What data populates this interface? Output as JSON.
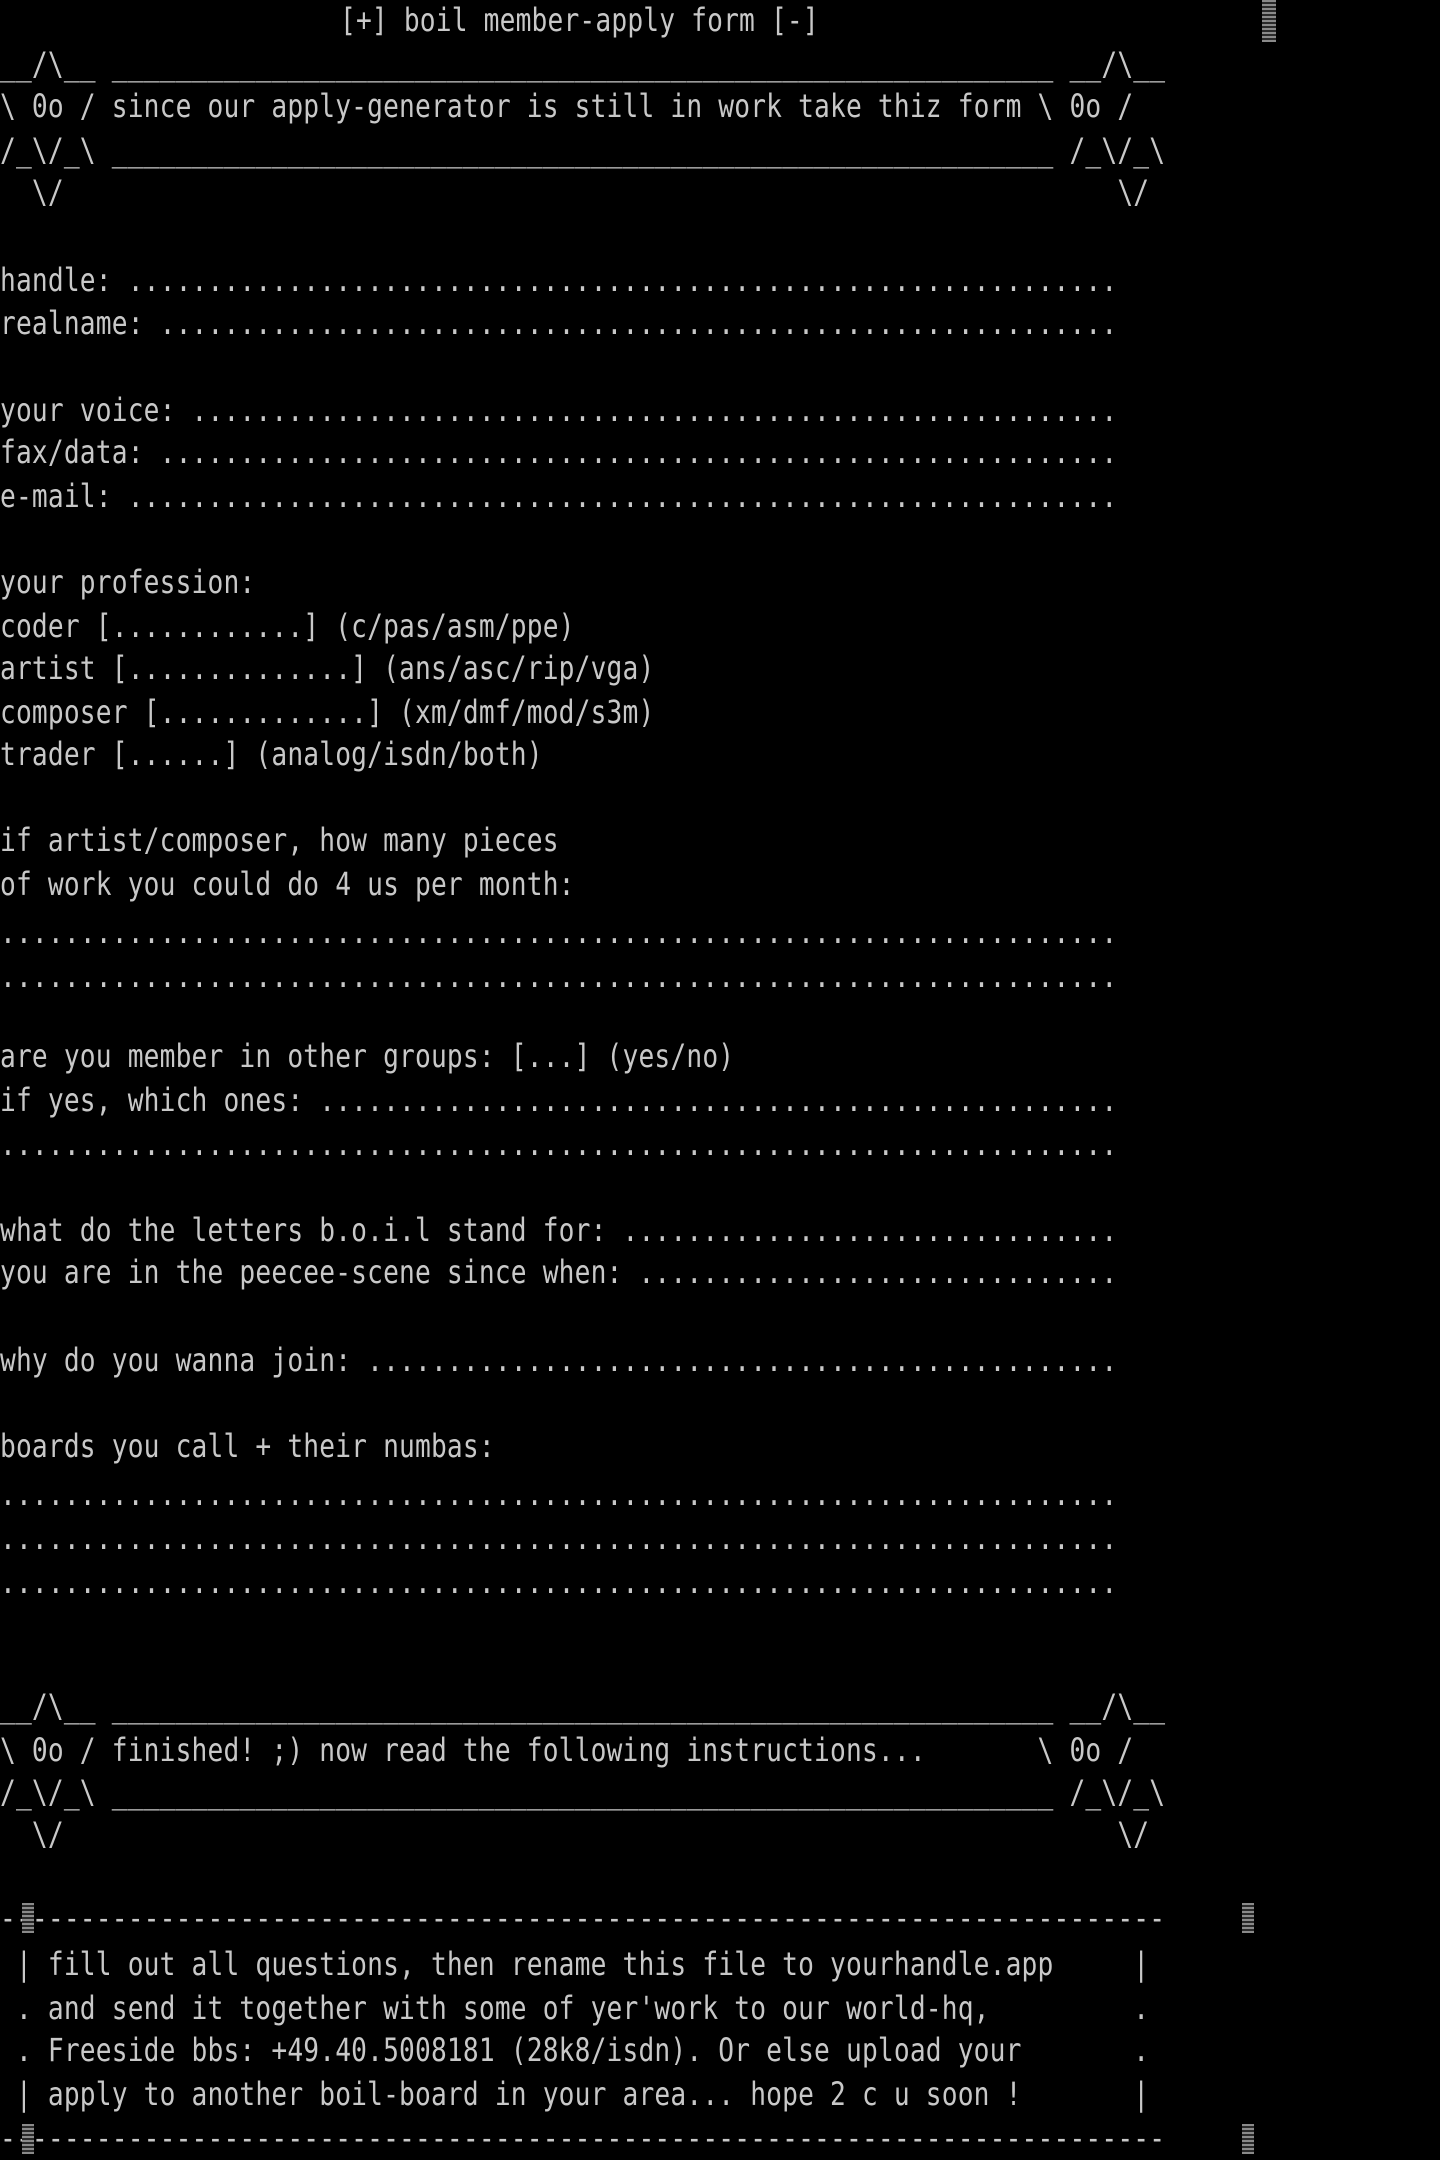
{
  "title": "[+] boil member-apply form [-]",
  "header_box": {
    "row1": "__/\\__ ___________________________________________________________ __/\\__",
    "row2": "\\ 0o / since our apply-generator is still in work take thiz form \\ 0o /",
    "row3": "/_\\/_\\ ___________________________________________________________ /_\\/_\\",
    "row4": "  \\/                                                                  \\/"
  },
  "form": {
    "handle": "handle: ..............................................................",
    "realname": "realname: ............................................................",
    "voice": "your voice: ..........................................................",
    "faxdata": "fax/data: ............................................................",
    "email": "e-mail: ..............................................................",
    "profession_heading": "your profession:",
    "coder": "coder [............] (c/pas/asm/ppe)",
    "artist": "artist [..............] (ans/asc/rip/vga)",
    "composer": "composer [.............] (xm/dmf/mod/s3m)",
    "trader": "trader [......] (analog/isdn/both)",
    "pieces_q1": "if artist/composer, how many pieces",
    "pieces_q2": "of work you could do 4 us per month:",
    "pieces_line1": "......................................................................",
    "pieces_line2": "......................................................................",
    "groups_q": "are you member in other groups: [...] (yes/no)",
    "groups_which": "if yes, which ones: ..................................................",
    "groups_line2": "......................................................................",
    "letters_q": "what do the letters b.o.i.l stand for: ...............................",
    "scene_q": "you are in the peecee-scene since when: ..............................",
    "join_q": "why do you wanna join: ...............................................",
    "boards_q": "boards you call + their numbas:",
    "boards_line1": "......................................................................",
    "boards_line2": "......................................................................",
    "boards_line3": "......................................................................"
  },
  "footer_box": {
    "row1": "__/\\__ ___________________________________________________________ __/\\__",
    "row2": "\\ 0o / finished! ;) now read the following instructions...       \\ 0o /",
    "row3": "/_\\/_\\ ___________________________________________________________ /_\\/_\\",
    "row4": "  \\/                                                                  \\/"
  },
  "instructions": {
    "border_top": "-------------------------------------------------------------------------",
    "line1": " | fill out all questions, then rename this file to yourhandle.app     |",
    "line2": " . and send it together with some of yer'work to our world-hq,         .",
    "line3": " . Freeside bbs: +49.40.5008181 (28k8/isdn). Or else upload your       .",
    "line4": " | apply to another boil-board in your area... hope 2 c u soon !       |",
    "border_bottom": "-------------------------------------------------------------------------"
  },
  "colors": {
    "background": "#000000",
    "text": "#c8c8c8"
  }
}
